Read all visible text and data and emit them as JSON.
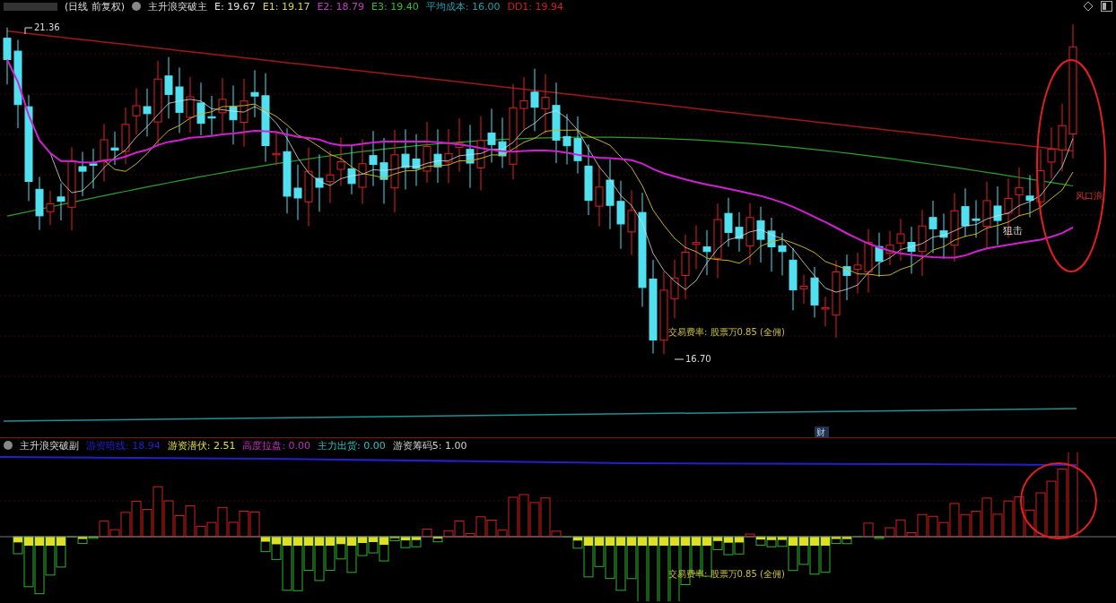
{
  "main_panel": {
    "period": "(日线 前复权)",
    "indicator_name": "主升浪突破主",
    "values": [
      {
        "text": "E: 19.67",
        "color": "#e6e6e6"
      },
      {
        "text": "E1: 19.17",
        "color": "#d8d840"
      },
      {
        "text": "E2: 18.79",
        "color": "#c040c0"
      },
      {
        "text": "E3: 19.40",
        "color": "#30c030"
      },
      {
        "text": "平均成本: 16.00",
        "color": "#20a0b0"
      },
      {
        "text": "DD1: 19.94",
        "color": "#d02020"
      }
    ],
    "high_label": "21.36",
    "low_label": "16.70",
    "fee_note": "交易费率: 股票万0.85 (全佣)",
    "snipe_label": "狙击",
    "wind_label": "风口浪",
    "finance_badge": "财"
  },
  "sub_panel": {
    "indicator_name": "主升浪突破副",
    "values": [
      {
        "text": "游资暗线: 18.94",
        "color": "#2020d0"
      },
      {
        "text": "游资潜伏: 2.51",
        "color": "#e0e040"
      },
      {
        "text": "高度拉盘: 0.00",
        "color": "#c030c0"
      },
      {
        "text": "主力出货: 0.00",
        "color": "#30c0c0"
      },
      {
        "text": "游资筹码5: 1.00",
        "color": "#d0d0d0"
      }
    ],
    "fee_note": "交易费率: 股票万0.85 (全佣)"
  }
}
